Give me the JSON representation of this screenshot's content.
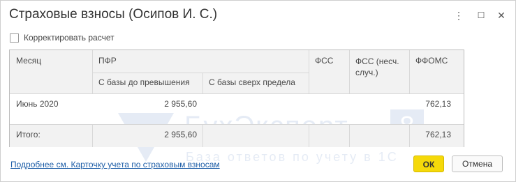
{
  "window": {
    "title": "Страховые взносы (Осипов И. С.)",
    "buttons": {
      "more": "⋮",
      "maximize": "☐",
      "close": "✕"
    }
  },
  "options": {
    "adjust_label": "Корректировать расчет",
    "adjust_checked": false
  },
  "table": {
    "headers": {
      "month": "Месяц",
      "pfr": "ПФР",
      "pfr_base_below": "С базы до превышения",
      "pfr_base_above": "С базы сверх предела",
      "fss": "ФСС",
      "fss_accident_line1": "ФСС (несч.",
      "fss_accident_line2": "случ.)",
      "ffoms": "ФФОМС"
    },
    "rows": [
      {
        "month": "Июнь 2020",
        "pfr_below": "2 955,60",
        "pfr_above": "",
        "fss": "",
        "fss_accident": "",
        "ffoms": "762,13"
      }
    ],
    "total": {
      "label": "Итого:",
      "pfr_below": "2 955,60",
      "pfr_above": "",
      "fss": "",
      "fss_accident": "",
      "ffoms": "762,13"
    }
  },
  "watermark": {
    "brand": "БухЭксперт",
    "number": "8",
    "tagline": "База ответов по учету в 1С"
  },
  "footer": {
    "details_link": "Подробнее см. Карточку учета по страховым взносам",
    "ok_label": "ОК",
    "cancel_label": "Отмена"
  }
}
